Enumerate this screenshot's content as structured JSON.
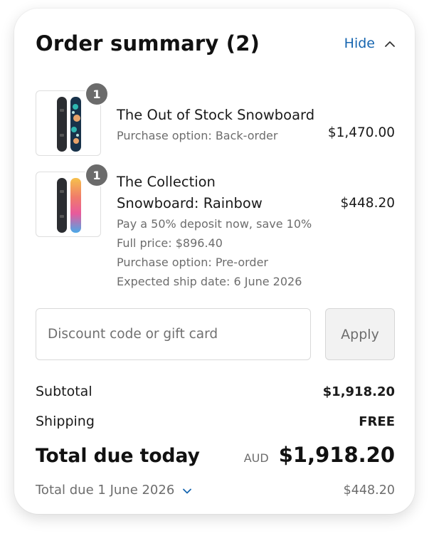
{
  "order_summary": {
    "title": "Order summary (2)",
    "hide_label": "Hide"
  },
  "items": [
    {
      "name": "The Out of Stock Snowboard",
      "quantity": "1",
      "meta": [
        "Purchase option: Back-order"
      ],
      "price": "$1,470.00"
    },
    {
      "name": "The Collection Snowboard: Rainbow",
      "quantity": "1",
      "meta": [
        "Pay a 50% deposit now, save 10%",
        "Full price: $896.40",
        "Purchase option: Pre-order",
        "Expected ship date: 6 June 2026"
      ],
      "price": "$448.20"
    }
  ],
  "discount": {
    "placeholder": "Discount code or gift card",
    "apply_label": "Apply"
  },
  "totals": {
    "subtotal_label": "Subtotal",
    "subtotal_value": "$1,918.20",
    "shipping_label": "Shipping",
    "shipping_value": "FREE",
    "total_label": "Total due today",
    "currency": "AUD",
    "total_value": "$1,918.20",
    "due_later_label": "Total due 1 June 2026",
    "due_later_value": "$448.20"
  },
  "colors": {
    "link": "#1766b0",
    "muted_text": "#6d6d6d",
    "badge": "#6b6b6b"
  }
}
